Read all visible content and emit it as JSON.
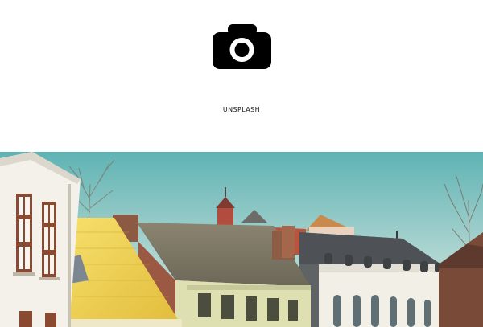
{
  "site": {
    "name": "UNSPLASH",
    "logo_icon": "camera-icon",
    "logo_color": "#000000"
  },
  "hero": {
    "photo_subject": "old-town-houses-under-sky",
    "colors": {
      "sky": "#8fc9c6",
      "yellow_roof": "#f1d553",
      "tile_roof": "#7d7867",
      "slate_roof": "#5a5d60",
      "white_facade": "#f3f1ea"
    }
  }
}
